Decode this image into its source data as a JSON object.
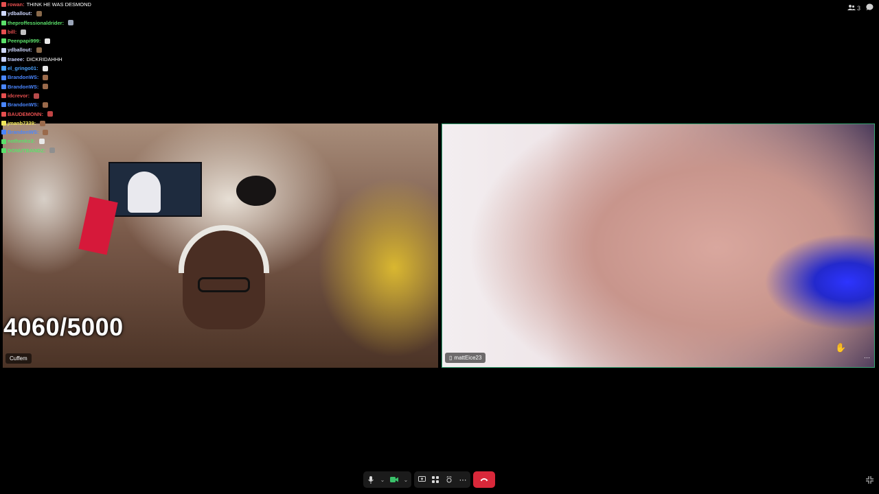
{
  "header": {
    "participant_count": "3",
    "people_icon": "people-icon",
    "chat_icon": "chat-bubble-icon"
  },
  "chat": {
    "messages": [
      {
        "user": "rowan:",
        "text": "THINK HE WAS DESMOND",
        "color": "#e64f4f",
        "emote": ""
      },
      {
        "user": "ydballout:",
        "text": "",
        "color": "#cfd8ff",
        "emote": "#8a6a4b"
      },
      {
        "user": "theproffessionaldrider:",
        "text": "",
        "color": "#5be06a",
        "emote": "#9aa5b8"
      },
      {
        "user": "bill:",
        "text": "",
        "color": "#e64f4f",
        "emote": "#c2c2c2"
      },
      {
        "user": "Peenpapi999:",
        "text": "",
        "color": "#5be06a",
        "emote": "#e8e8e8"
      },
      {
        "user": "ydballout:",
        "text": "",
        "color": "#cfd8ff",
        "emote": "#8a6a4b"
      },
      {
        "user": "traeee:",
        "text": "DICKRIDAHHH",
        "color": "#c9d3ff",
        "emote": ""
      },
      {
        "user": "el_gringo01:",
        "text": "",
        "color": "#4aa3ff",
        "emote": "#e8e8e8"
      },
      {
        "user": "BrandonWS:",
        "text": "",
        "color": "#4a86ff",
        "emote": "#9a6a4b"
      },
      {
        "user": "BrandonWS:",
        "text": "",
        "color": "#4a86ff",
        "emote": "#9a6a4b"
      },
      {
        "user": "idcrevor:",
        "text": "",
        "color": "#e64f4f",
        "emote": "#b84b4b"
      },
      {
        "user": "BrandonWS:",
        "text": "",
        "color": "#4a86ff",
        "emote": "#9a6a4b"
      },
      {
        "user": "BAUDEMONN:",
        "text": "",
        "color": "#e64f4f",
        "emote": "#c04444"
      },
      {
        "user": "jmanb7339:",
        "text": "",
        "color": "#f0e65a",
        "emote": "#9a6a4b"
      },
      {
        "user": "BrandonWS:",
        "text": "",
        "color": "#4a86ff",
        "emote": "#9a6a4b"
      },
      {
        "user": "nothenks3:",
        "text": "",
        "color": "#5be06a",
        "emote": "#e8e8e8"
      },
      {
        "user": "DONUTBANDZ:",
        "text": "",
        "color": "#5be06a",
        "emote": "#8f8f8f"
      }
    ]
  },
  "tiles": {
    "left": {
      "name": "Cuffem",
      "overlay_counter": "4060/5000"
    },
    "right": {
      "name": "mattEice23",
      "device_icon": "phone-icon"
    }
  },
  "controls": {
    "mic_icon": "microphone-icon",
    "camera_icon": "camera-icon",
    "share_icon": "screen-share-icon",
    "layout_icon": "grid-layout-icon",
    "effects_icon": "effects-icon",
    "more_icon": "more-icon",
    "end_call_icon": "end-call-icon",
    "collapse_icon": "collapse-icon"
  }
}
